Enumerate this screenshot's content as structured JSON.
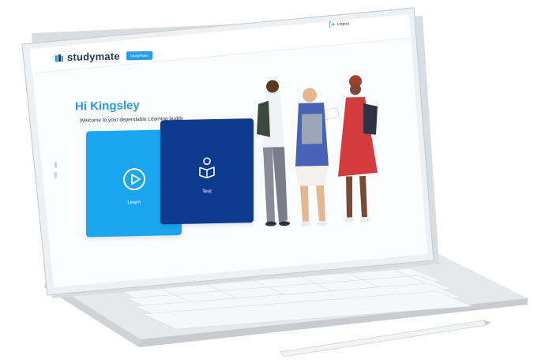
{
  "header": {
    "brand_name": "studymate",
    "brand_badge": "StudyPlans",
    "brand_icon": "book-stack-icon",
    "logout_label": "Logout",
    "logout_icon": "logout-arrow-icon"
  },
  "main": {
    "greeting": "Hi Kingsley",
    "welcome_text": "Welcome to your dependable Learning buddy",
    "cards": [
      {
        "label": "Learn",
        "icon": "play-circle-icon",
        "color": "#1aa6ef"
      },
      {
        "label": "Test",
        "icon": "person-reading-icon",
        "color": "#0b3a8f"
      }
    ]
  },
  "colors": {
    "accent": "#2a9be8",
    "learn_card": "#1aa6ef",
    "test_card": "#0b3a8f",
    "brand_text": "#1f3a60"
  }
}
